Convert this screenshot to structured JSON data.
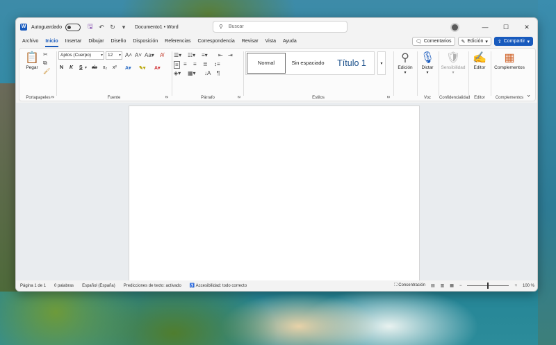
{
  "titlebar": {
    "autosave_label": "Autoguardado",
    "doc_title": "Documento1 • Word",
    "search_placeholder": "Buscar",
    "minimize": "—",
    "maximize": "☐",
    "close": "✕"
  },
  "tabs": [
    "Archivo",
    "Inicio",
    "Insertar",
    "Dibujar",
    "Diseño",
    "Disposición",
    "Referencias",
    "Correspondencia",
    "Revisar",
    "Vista",
    "Ayuda"
  ],
  "active_tab": "Inicio",
  "tab_actions": {
    "comments": "Comentarios",
    "editing": "Edición",
    "share": "Compartir"
  },
  "ribbon": {
    "clipboard": {
      "paste": "Pegar",
      "label": "Portapapeles"
    },
    "font": {
      "name": "Aptos (Cuerpo)",
      "size": "12",
      "label": "Fuente"
    },
    "paragraph": {
      "label": "Párrafo"
    },
    "styles": {
      "normal": "Normal",
      "no_spacing": "Sin espaciado",
      "heading1": "Título 1",
      "label": "Estilos"
    },
    "editing": {
      "button": "Edición",
      "label": ""
    },
    "voice": {
      "button": "Dictar",
      "label": "Voz"
    },
    "sensitivity": {
      "button": "Sensibilidad",
      "label": "Confidencialidad"
    },
    "editor": {
      "button": "Editor",
      "label": "Editor"
    },
    "addins": {
      "button": "Complementos",
      "label": "Complementos"
    }
  },
  "statusbar": {
    "page": "Página 1 de 1",
    "words": "0 palabras",
    "language": "Español (España)",
    "predictions": "Predicciones de texto: activado",
    "accessibility": "Accesibilidad: todo correcto",
    "focus": "Concentración",
    "zoom": "100 %"
  },
  "colors": {
    "accent": "#185abd",
    "highlight": "#ffff00",
    "font_color": "#d13438"
  }
}
